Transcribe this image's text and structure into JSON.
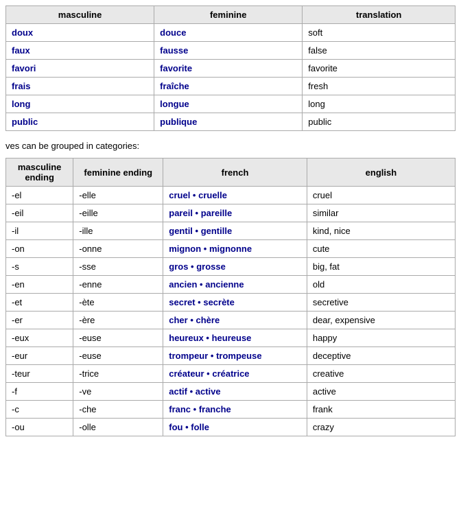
{
  "topTable": {
    "headers": [
      "masculine",
      "feminine",
      "translation"
    ],
    "rows": [
      {
        "masc": "doux",
        "fem": "douce",
        "trans": "soft"
      },
      {
        "masc": "faux",
        "fem": "fausse",
        "trans": "false"
      },
      {
        "masc": "favori",
        "fem": "favorite",
        "trans": "favorite"
      },
      {
        "masc": "frais",
        "fem": "fraîche",
        "trans": "fresh"
      },
      {
        "masc": "long",
        "fem": "longue",
        "trans": "long"
      },
      {
        "masc": "public",
        "fem": "publique",
        "trans": "public"
      }
    ]
  },
  "introText": "ves can be grouped in categories:",
  "endingTable": {
    "headers": [
      "masculine ending",
      "feminine ending",
      "french",
      "english"
    ],
    "rows": [
      {
        "mascEnd": "-el",
        "femEnd": "-elle",
        "french": "cruel • cruelle",
        "english": "cruel"
      },
      {
        "mascEnd": "-eil",
        "femEnd": "-eille",
        "french": "pareil • pareille",
        "english": "similar"
      },
      {
        "mascEnd": "-il",
        "femEnd": "-ille",
        "french": "gentil • gentille",
        "english": "kind, nice"
      },
      {
        "mascEnd": "-on",
        "femEnd": "-onne",
        "french": "mignon • mignonne",
        "english": "cute"
      },
      {
        "mascEnd": "-s",
        "femEnd": "-sse",
        "french": "gros • grosse",
        "english": "big, fat"
      },
      {
        "mascEnd": "-en",
        "femEnd": "-enne",
        "french": "ancien • ancienne",
        "english": "old"
      },
      {
        "mascEnd": "-et",
        "femEnd": "-ète",
        "french": "secret • secrète",
        "english": "secretive"
      },
      {
        "mascEnd": "-er",
        "femEnd": "-ère",
        "french": "cher • chère",
        "english": "dear, expensive"
      },
      {
        "mascEnd": "-eux",
        "femEnd": "-euse",
        "french": "heureux • heureuse",
        "english": "happy"
      },
      {
        "mascEnd": "-eur",
        "femEnd": "-euse",
        "french": "trompeur • trompeuse",
        "english": "deceptive"
      },
      {
        "mascEnd": "-teur",
        "femEnd": "-trice",
        "french": "créateur • créatrice",
        "english": "creative"
      },
      {
        "mascEnd": "-f",
        "femEnd": "-ve",
        "french": "actif • active",
        "english": "active"
      },
      {
        "mascEnd": "-c",
        "femEnd": "-che",
        "french": "franc • franche",
        "english": "frank"
      },
      {
        "mascEnd": "-ou",
        "femEnd": "-olle",
        "french": "fou • folle",
        "english": "crazy"
      }
    ]
  }
}
